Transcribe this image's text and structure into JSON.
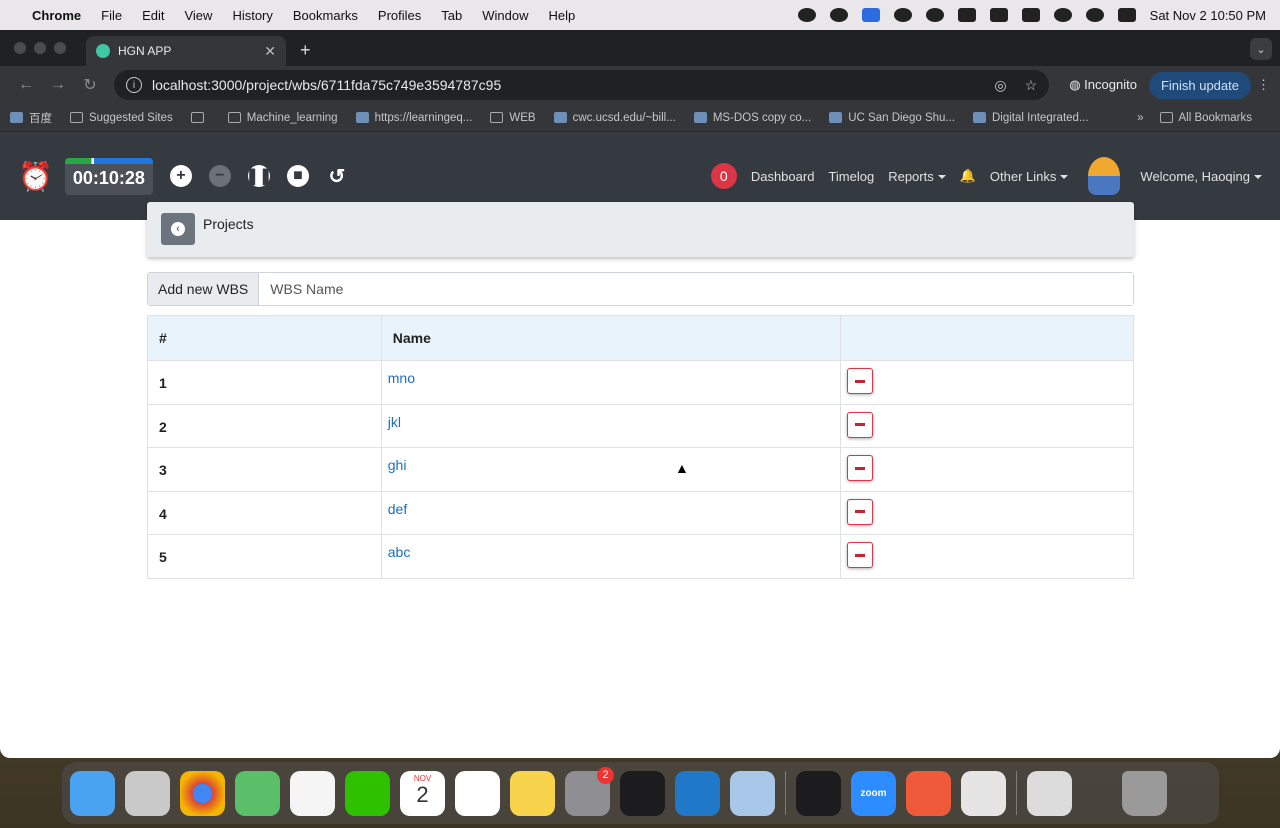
{
  "menubar": {
    "app": "Chrome",
    "items": [
      "File",
      "Edit",
      "View",
      "History",
      "Bookmarks",
      "Profiles",
      "Tab",
      "Window",
      "Help"
    ],
    "clock": "Sat Nov 2  10:50 PM"
  },
  "browser": {
    "tab_title": "HGN APP",
    "url": "localhost:3000/project/wbs/6711fda75c749e3594787c95",
    "incognito_label": "Incognito",
    "finish_update_label": "Finish update",
    "bookmarks": [
      "百度",
      "Suggested Sites",
      "Machine_learning",
      "https://learningeq...",
      "WEB",
      "cwc.ucsd.edu/~bill...",
      "MS-DOS copy co...",
      "UC San Diego Shu...",
      "Digital Integrated..."
    ],
    "all_bookmarks_label": "All Bookmarks"
  },
  "app_header": {
    "timer": "00:10:28",
    "notification_count": "0",
    "nav": {
      "dashboard": "Dashboard",
      "timelog": "Timelog",
      "reports": "Reports",
      "other_links": "Other Links",
      "welcome": "Welcome, Haoqing"
    }
  },
  "page": {
    "breadcrumb_title": "Projects",
    "add_wbs_label": "Add new WBS",
    "wbs_input_placeholder": "WBS Name",
    "table": {
      "headers": [
        "#",
        "Name",
        ""
      ],
      "rows": [
        {
          "num": "1",
          "name": "mno"
        },
        {
          "num": "2",
          "name": "jkl"
        },
        {
          "num": "3",
          "name": "ghi"
        },
        {
          "num": "4",
          "name": "def"
        },
        {
          "num": "5",
          "name": "abc"
        }
      ]
    }
  },
  "dock": {
    "calendar_month": "NOV",
    "calendar_day": "2",
    "settings_badge": "2",
    "zoom_label": "zoom"
  },
  "colors": {
    "app_header_bg": "#343a40",
    "link_blue": "#1a6fc4",
    "danger_red": "#dc3545",
    "table_header_bg": "#e8f3fc"
  }
}
